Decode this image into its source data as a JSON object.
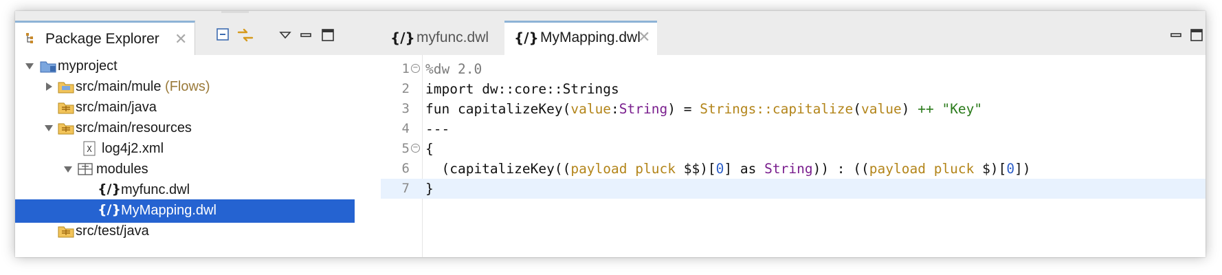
{
  "package_explorer": {
    "tab_title": "Package Explorer",
    "tab_close": "✕",
    "toolbar_icons": [
      "collapse-all-icon",
      "link-with-editor-icon",
      "view-menu-icon",
      "minimize-icon",
      "maximize-icon"
    ],
    "tree": [
      {
        "label": "myproject",
        "decoration": "",
        "expanded": true,
        "icon": "project-icon"
      },
      {
        "label": "src/main/mule",
        "decoration": " (Flows)",
        "expanded": false,
        "icon": "source-folder-icon"
      },
      {
        "label": "src/main/java",
        "decoration": "",
        "icon": "source-folder-icon"
      },
      {
        "label": "src/main/resources",
        "decoration": "",
        "expanded": true,
        "icon": "source-folder-icon"
      },
      {
        "label": "log4j2.xml",
        "decoration": "",
        "icon": "xml-file-icon"
      },
      {
        "label": "modules",
        "decoration": "",
        "expanded": true,
        "icon": "package-icon"
      },
      {
        "label": "myfunc.dwl",
        "decoration": "",
        "icon": "dwl-file-icon"
      },
      {
        "label": "MyMapping.dwl",
        "decoration": "",
        "icon": "dwl-file-icon",
        "selected": true
      },
      {
        "label": "src/test/java",
        "decoration": "",
        "icon": "source-folder-icon"
      }
    ]
  },
  "editor": {
    "tabs": [
      {
        "label": "myfunc.dwl",
        "active": false,
        "icon_text": "{/}"
      },
      {
        "label": "MyMapping.dwl",
        "active": true,
        "icon_text": "{/}",
        "close": "✕"
      }
    ],
    "line_numbers": [
      "1",
      "2",
      "3",
      "4",
      "5",
      "6",
      "7"
    ],
    "current_line": 7
  },
  "colors": {
    "selection": "#2563d1",
    "tab_accent": "#8db3d6",
    "current_line": "#e8f2fe",
    "keyword_function": "#b3851a",
    "type": "#7a1f8e",
    "string": "#2a7a1a"
  }
}
